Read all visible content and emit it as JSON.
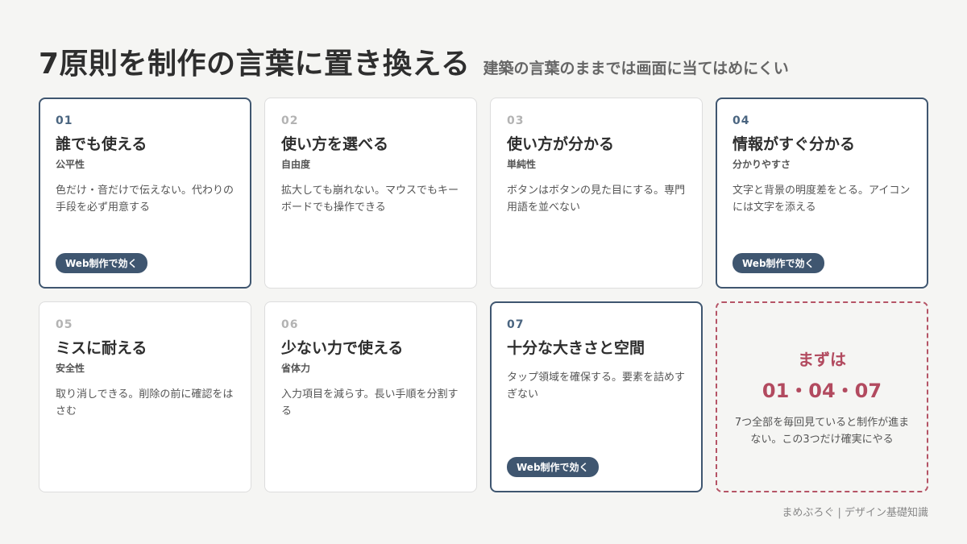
{
  "header": {
    "title": "7原則を制作の言葉に置き換える",
    "subtitle": "建築の言葉のままでは画面に当てはめにくい"
  },
  "cards": [
    {
      "num": "01",
      "heading": "誰でも使える",
      "category": "公平性",
      "desc": "色だけ・音だけで伝えない。代わりの手段を必ず用意する",
      "badge": "Web制作で効く",
      "highlight": true
    },
    {
      "num": "02",
      "heading": "使い方を選べる",
      "category": "自由度",
      "desc": "拡大しても崩れない。マウスでもキーボードでも操作できる",
      "badge": "",
      "highlight": false
    },
    {
      "num": "03",
      "heading": "使い方が分かる",
      "category": "単純性",
      "desc": "ボタンはボタンの見た目にする。専門用語を並べない",
      "badge": "",
      "highlight": false
    },
    {
      "num": "04",
      "heading": "情報がすぐ分かる",
      "category": "分かりやすさ",
      "desc": "文字と背景の明度差をとる。アイコンには文字を添える",
      "badge": "Web制作で効く",
      "highlight": true
    },
    {
      "num": "05",
      "heading": "ミスに耐える",
      "category": "安全性",
      "desc": "取り消しできる。削除の前に確認をはさむ",
      "badge": "",
      "highlight": false
    },
    {
      "num": "06",
      "heading": "少ない力で使える",
      "category": "省体力",
      "desc": "入力項目を減らす。長い手順を分割する",
      "badge": "",
      "highlight": false
    },
    {
      "num": "07",
      "heading": "十分な大きさと空間",
      "category": "",
      "desc": "タップ領域を確保する。要素を詰めすぎない",
      "badge": "Web制作で効く",
      "highlight": true
    }
  ],
  "cta": {
    "line1": "まずは",
    "line2": "01・04・07",
    "desc": "7つ全部を毎回見ていると制作が進まない。この3つだけ確実にやる"
  },
  "footer": "まめぶろぐ | デザイン基礎知識",
  "colors": {
    "accent": "#3f5670",
    "cta": "#b24a5f",
    "background": "#f5f5f3"
  }
}
